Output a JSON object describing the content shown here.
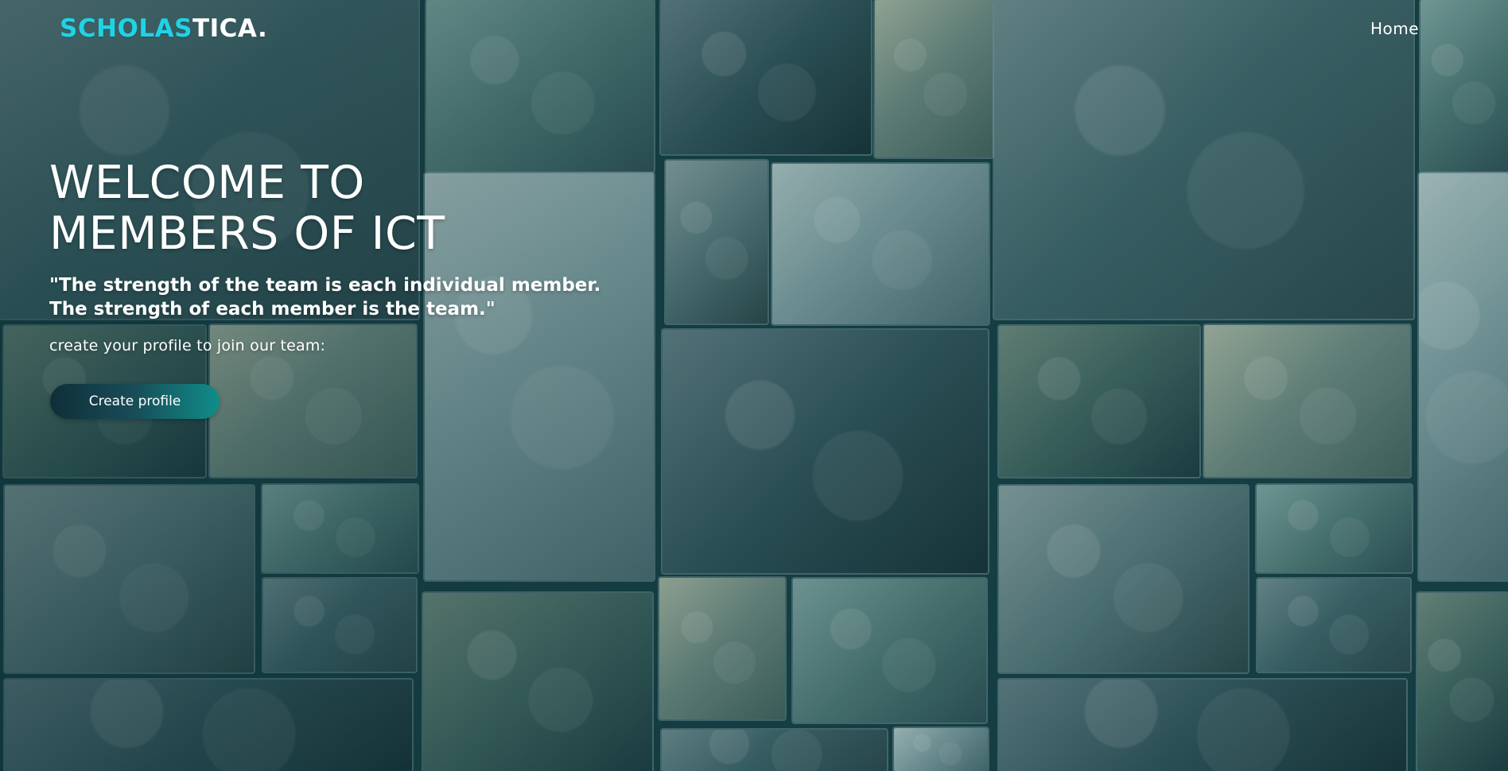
{
  "header": {
    "brand_accent": "SCHOLAS",
    "brand_rest": "TICA.",
    "nav_home": "Home"
  },
  "hero": {
    "title_line1": "WELCOME TO",
    "title_line2": "MEMBERS OF ICT",
    "quote_line1": "\"The strength of the team is each individual member.",
    "quote_line2": "The strength of each member is the team.\"",
    "subtitle": "create your profile to join our team:",
    "cta_label": "Create profile"
  },
  "colors": {
    "brand_accent": "#1fd3e6",
    "button_start": "#0f2f3a",
    "button_end": "#0f8d89"
  }
}
